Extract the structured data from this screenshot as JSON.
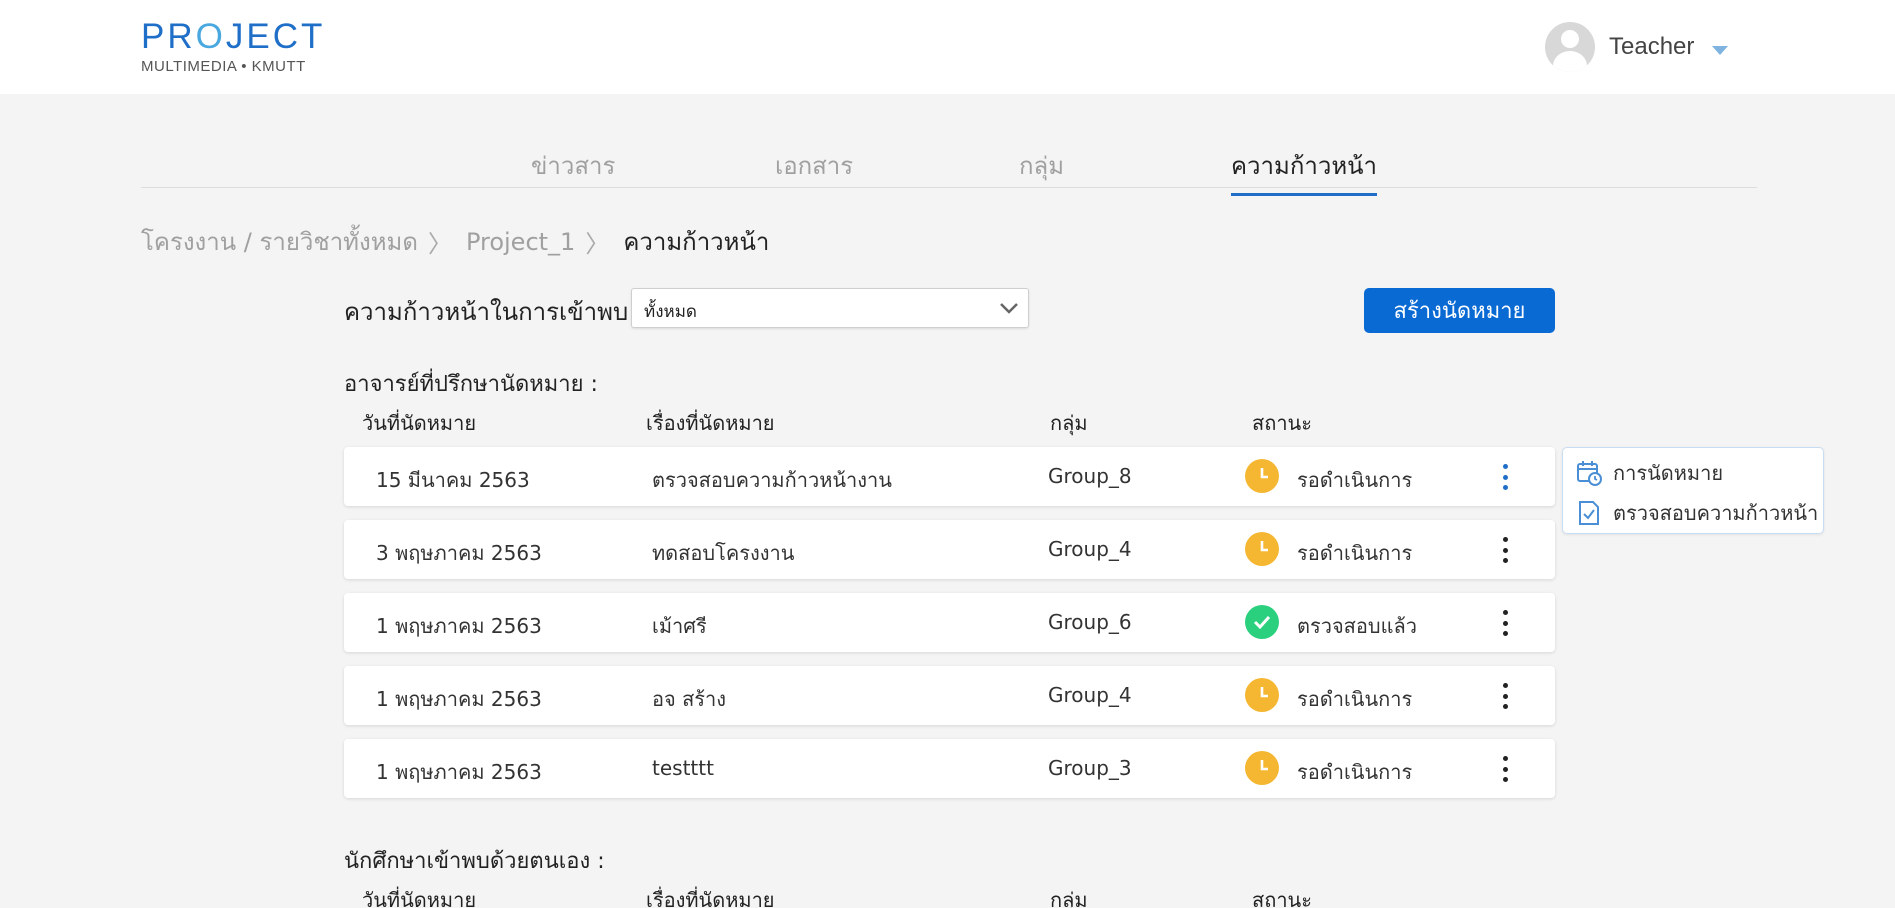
{
  "header": {
    "logo_word_a": "PR",
    "logo_word_o": "O",
    "logo_word_b": "JECT",
    "logo_sub": "MULTIMEDIA • KMUTT",
    "user_name": "Teacher"
  },
  "tabs": [
    {
      "label": "ข่าวสาร",
      "active": false
    },
    {
      "label": "เอกสาร",
      "active": false
    },
    {
      "label": "กลุ่ม",
      "active": false
    },
    {
      "label": "ความก้าวหน้า",
      "active": true
    }
  ],
  "breadcrumb": {
    "items": [
      "โครงงาน / รายวิชาทั้งหมด",
      "Project_1"
    ],
    "current": "ความก้าวหน้า",
    "separator": "〉"
  },
  "filter": {
    "label": "ความก้าวหน้าในการเข้าพบ",
    "selected": "ทั้งหมด"
  },
  "create_button": "สร้างนัดหมาย",
  "advisor_section": {
    "title": "อาจารย์ที่ปรึกษานัดหมาย :",
    "columns": [
      "วันที่นัดหมาย",
      "เรื่องที่นัดหมาย",
      "กลุ่ม",
      "สถานะ"
    ],
    "rows": [
      {
        "date": "15 มีนาคม 2563",
        "topic": "ตรวจสอบความก้าวหน้างาน",
        "group": "Group_8",
        "status": "รอดำเนินการ",
        "state": "pending"
      },
      {
        "date": "3 พฤษภาคม 2563",
        "topic": "ทดสอบโครงงาน",
        "group": "Group_4",
        "status": "รอดำเนินการ",
        "state": "pending"
      },
      {
        "date": "1 พฤษภาคม 2563",
        "topic": "เม้าศรี",
        "group": "Group_6",
        "status": "ตรวจสอบแล้ว",
        "state": "done"
      },
      {
        "date": "1 พฤษภาคม 2563",
        "topic": "อจ สร้าง",
        "group": "Group_4",
        "status": "รอดำเนินการ",
        "state": "pending"
      },
      {
        "date": "1 พฤษภาคม 2563",
        "topic": "testttt",
        "group": "Group_3",
        "status": "รอดำเนินการ",
        "state": "pending"
      }
    ]
  },
  "context_menu": {
    "items": [
      {
        "label": "การนัดหมาย",
        "icon": "calendar-clock-icon"
      },
      {
        "label": "ตรวจสอบความก้าวหน้า",
        "icon": "document-check-icon"
      }
    ]
  },
  "student_section": {
    "title": "นักศึกษาเข้าพบด้วยตนเอง :",
    "columns": [
      "วันที่นัดหมาย",
      "เรื่องที่นัดหมาย",
      "กลุ่ม",
      "สถานะ"
    ]
  },
  "colors": {
    "primary": "#0a6ad4",
    "pending": "#f5b731",
    "done": "#2bd07e"
  }
}
